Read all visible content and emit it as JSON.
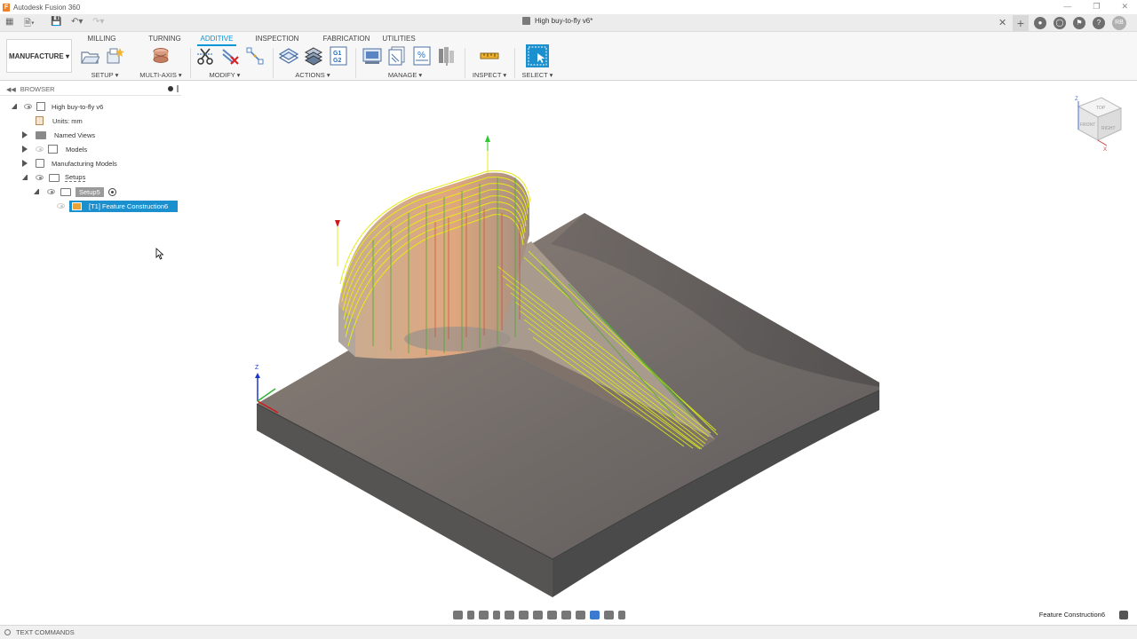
{
  "window": {
    "app_title": "Autodesk Fusion 360",
    "document_title": "High buy-to-fly v6*",
    "user_initials": "RB"
  },
  "ribbon": {
    "workspace": "MANUFACTURE ▾",
    "tabs": [
      "MILLING",
      "TURNING",
      "ADDITIVE",
      "INSPECTION",
      "FABRICATION",
      "UTILITIES"
    ],
    "active_tab": "ADDITIVE",
    "groups": {
      "setup": "SETUP ▾",
      "multi_axis": "MULTI-AXIS ▾",
      "modify": "MODIFY ▾",
      "actions": "ACTIONS ▾",
      "manage": "MANAGE ▾",
      "inspect": "INSPECT ▾",
      "select": "SELECT ▾"
    },
    "accent_color": "#0696d7"
  },
  "browser": {
    "title": "BROWSER",
    "root": "High buy-to-fly v6",
    "units": "Units: mm",
    "named_views": "Named Views",
    "models": "Models",
    "manufacturing_models": "Manufacturing Models",
    "setups": "Setups",
    "setup": "Setup5",
    "operation": "[T1] Feature Construction6"
  },
  "viewcube": {
    "top": "TOP",
    "front": "FRONT",
    "right": "RIGHT",
    "axis_z": "Z",
    "axis_x": "X"
  },
  "viewport": {
    "triad_z": "Z"
  },
  "status": {
    "selection": "Feature Construction6",
    "text_commands": "TEXT COMMANDS"
  }
}
